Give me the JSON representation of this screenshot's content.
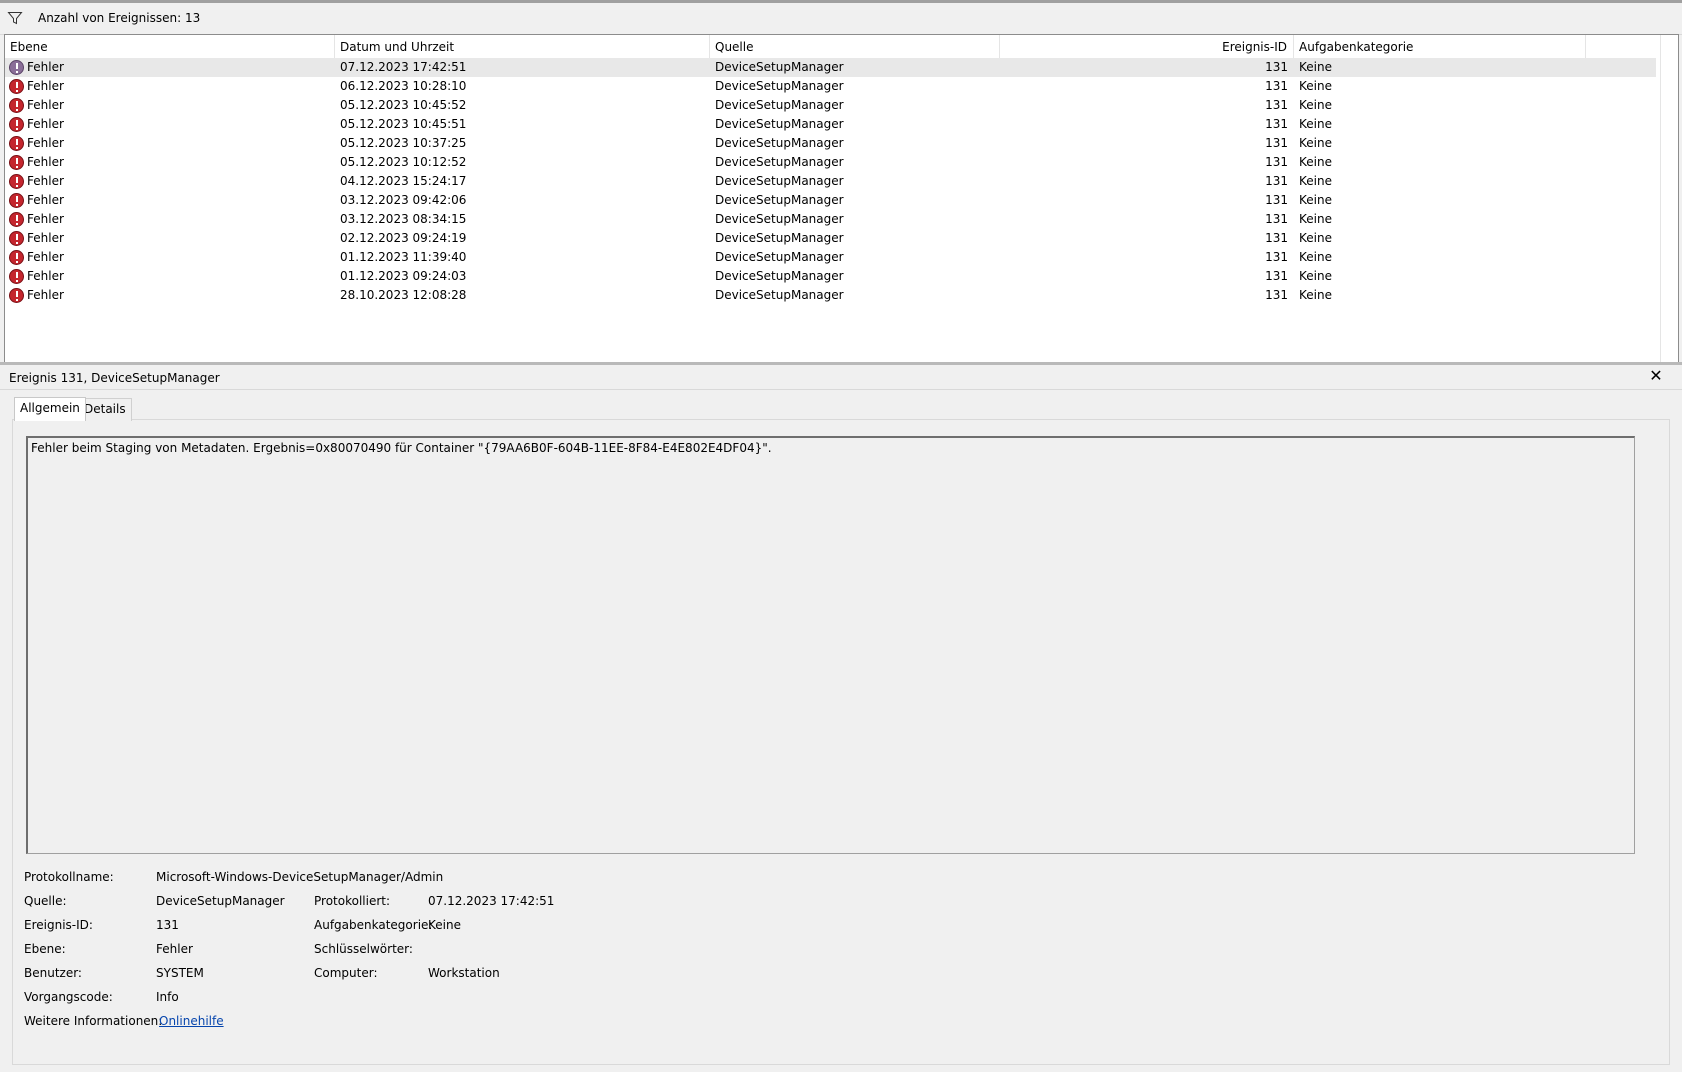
{
  "toolbar": {
    "filter_icon": "filter-funnel-icon",
    "event_count_label": "Anzahl von Ereignissen: 13"
  },
  "list": {
    "columns": [
      "Ebene",
      "Datum und Uhrzeit",
      "Quelle",
      "Ereignis-ID",
      "Aufgabenkategorie"
    ],
    "rows": [
      {
        "level": "Fehler",
        "datetime": "07.12.2023 17:42:51",
        "source": "DeviceSetupManager",
        "id": "131",
        "category": "Keine",
        "selected": true
      },
      {
        "level": "Fehler",
        "datetime": "06.12.2023 10:28:10",
        "source": "DeviceSetupManager",
        "id": "131",
        "category": "Keine"
      },
      {
        "level": "Fehler",
        "datetime": "05.12.2023 10:45:52",
        "source": "DeviceSetupManager",
        "id": "131",
        "category": "Keine"
      },
      {
        "level": "Fehler",
        "datetime": "05.12.2023 10:45:51",
        "source": "DeviceSetupManager",
        "id": "131",
        "category": "Keine"
      },
      {
        "level": "Fehler",
        "datetime": "05.12.2023 10:37:25",
        "source": "DeviceSetupManager",
        "id": "131",
        "category": "Keine"
      },
      {
        "level": "Fehler",
        "datetime": "05.12.2023 10:12:52",
        "source": "DeviceSetupManager",
        "id": "131",
        "category": "Keine"
      },
      {
        "level": "Fehler",
        "datetime": "04.12.2023 15:24:17",
        "source": "DeviceSetupManager",
        "id": "131",
        "category": "Keine"
      },
      {
        "level": "Fehler",
        "datetime": "03.12.2023 09:42:06",
        "source": "DeviceSetupManager",
        "id": "131",
        "category": "Keine"
      },
      {
        "level": "Fehler",
        "datetime": "03.12.2023 08:34:15",
        "source": "DeviceSetupManager",
        "id": "131",
        "category": "Keine"
      },
      {
        "level": "Fehler",
        "datetime": "02.12.2023 09:24:19",
        "source": "DeviceSetupManager",
        "id": "131",
        "category": "Keine"
      },
      {
        "level": "Fehler",
        "datetime": "01.12.2023 11:39:40",
        "source": "DeviceSetupManager",
        "id": "131",
        "category": "Keine"
      },
      {
        "level": "Fehler",
        "datetime": "01.12.2023 09:24:03",
        "source": "DeviceSetupManager",
        "id": "131",
        "category": "Keine"
      },
      {
        "level": "Fehler",
        "datetime": "28.10.2023 12:08:28",
        "source": "DeviceSetupManager",
        "id": "131",
        "category": "Keine"
      }
    ]
  },
  "detail": {
    "title": "Ereignis 131, DeviceSetupManager",
    "close_label": "✕",
    "tabs": [
      "Allgemein",
      "Details"
    ],
    "description": "Fehler beim Staging von Metadaten. Ergebnis=0x80070490 für Container \"{79AA6B0F-604B-11EE-8F84-E4E802E4DF04}\".",
    "props": {
      "protokollname_label": "Protokollname:",
      "protokollname_value": "Microsoft-Windows-DeviceSetupManager/Admin",
      "quelle_label": "Quelle:",
      "quelle_value": "DeviceSetupManager",
      "protokolliert_label": "Protokolliert:",
      "protokolliert_value": "07.12.2023 17:42:51",
      "ereignisid_label": "Ereignis-ID:",
      "ereignisid_value": "131",
      "aufgabenkategorie_label": "Aufgabenkategorie:",
      "aufgabenkategorie_value": "Keine",
      "ebene_label": "Ebene:",
      "ebene_value": "Fehler",
      "schluesselwoerter_label": "Schlüsselwörter:",
      "schluesselwoerter_value": "",
      "benutzer_label": "Benutzer:",
      "benutzer_value": "SYSTEM",
      "computer_label": "Computer:",
      "computer_value": "Workstation",
      "vorgangscode_label": "Vorgangscode:",
      "vorgangscode_value": "Info",
      "weitere_label": "Weitere Informationen:",
      "weitere_link": "Onlinehilfe"
    }
  },
  "colors": {
    "error_icon": "#c4262e",
    "link": "#0645ad",
    "selected_row": "#e8e8e8"
  }
}
